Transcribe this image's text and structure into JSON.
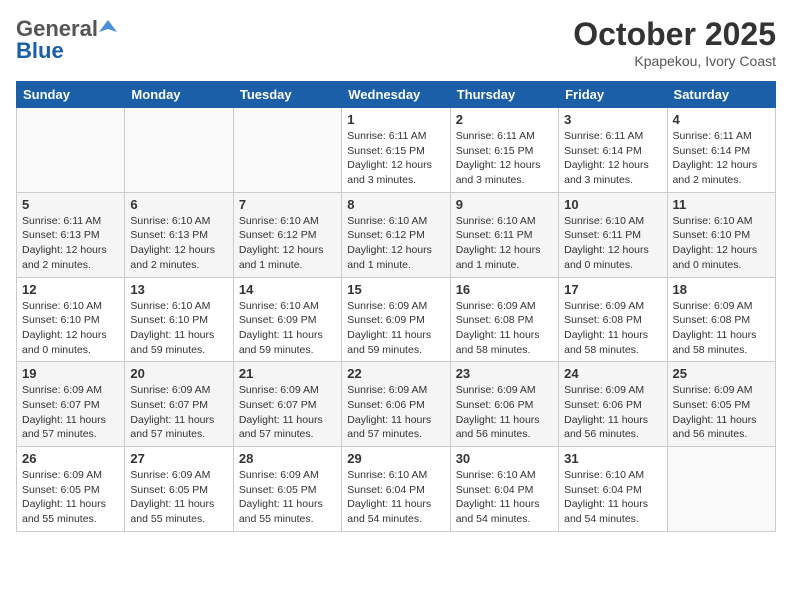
{
  "header": {
    "logo_general": "General",
    "logo_blue": "Blue",
    "month_title": "October 2025",
    "location": "Kpapekou, Ivory Coast"
  },
  "days_of_week": [
    "Sunday",
    "Monday",
    "Tuesday",
    "Wednesday",
    "Thursday",
    "Friday",
    "Saturday"
  ],
  "weeks": [
    [
      {
        "day": "",
        "content": ""
      },
      {
        "day": "",
        "content": ""
      },
      {
        "day": "",
        "content": ""
      },
      {
        "day": "1",
        "content": "Sunrise: 6:11 AM\nSunset: 6:15 PM\nDaylight: 12 hours and 3 minutes."
      },
      {
        "day": "2",
        "content": "Sunrise: 6:11 AM\nSunset: 6:15 PM\nDaylight: 12 hours and 3 minutes."
      },
      {
        "day": "3",
        "content": "Sunrise: 6:11 AM\nSunset: 6:14 PM\nDaylight: 12 hours and 3 minutes."
      },
      {
        "day": "4",
        "content": "Sunrise: 6:11 AM\nSunset: 6:14 PM\nDaylight: 12 hours and 2 minutes."
      }
    ],
    [
      {
        "day": "5",
        "content": "Sunrise: 6:11 AM\nSunset: 6:13 PM\nDaylight: 12 hours and 2 minutes."
      },
      {
        "day": "6",
        "content": "Sunrise: 6:10 AM\nSunset: 6:13 PM\nDaylight: 12 hours and 2 minutes."
      },
      {
        "day": "7",
        "content": "Sunrise: 6:10 AM\nSunset: 6:12 PM\nDaylight: 12 hours and 1 minute."
      },
      {
        "day": "8",
        "content": "Sunrise: 6:10 AM\nSunset: 6:12 PM\nDaylight: 12 hours and 1 minute."
      },
      {
        "day": "9",
        "content": "Sunrise: 6:10 AM\nSunset: 6:11 PM\nDaylight: 12 hours and 1 minute."
      },
      {
        "day": "10",
        "content": "Sunrise: 6:10 AM\nSunset: 6:11 PM\nDaylight: 12 hours and 0 minutes."
      },
      {
        "day": "11",
        "content": "Sunrise: 6:10 AM\nSunset: 6:10 PM\nDaylight: 12 hours and 0 minutes."
      }
    ],
    [
      {
        "day": "12",
        "content": "Sunrise: 6:10 AM\nSunset: 6:10 PM\nDaylight: 12 hours and 0 minutes."
      },
      {
        "day": "13",
        "content": "Sunrise: 6:10 AM\nSunset: 6:10 PM\nDaylight: 11 hours and 59 minutes."
      },
      {
        "day": "14",
        "content": "Sunrise: 6:10 AM\nSunset: 6:09 PM\nDaylight: 11 hours and 59 minutes."
      },
      {
        "day": "15",
        "content": "Sunrise: 6:09 AM\nSunset: 6:09 PM\nDaylight: 11 hours and 59 minutes."
      },
      {
        "day": "16",
        "content": "Sunrise: 6:09 AM\nSunset: 6:08 PM\nDaylight: 11 hours and 58 minutes."
      },
      {
        "day": "17",
        "content": "Sunrise: 6:09 AM\nSunset: 6:08 PM\nDaylight: 11 hours and 58 minutes."
      },
      {
        "day": "18",
        "content": "Sunrise: 6:09 AM\nSunset: 6:08 PM\nDaylight: 11 hours and 58 minutes."
      }
    ],
    [
      {
        "day": "19",
        "content": "Sunrise: 6:09 AM\nSunset: 6:07 PM\nDaylight: 11 hours and 57 minutes."
      },
      {
        "day": "20",
        "content": "Sunrise: 6:09 AM\nSunset: 6:07 PM\nDaylight: 11 hours and 57 minutes."
      },
      {
        "day": "21",
        "content": "Sunrise: 6:09 AM\nSunset: 6:07 PM\nDaylight: 11 hours and 57 minutes."
      },
      {
        "day": "22",
        "content": "Sunrise: 6:09 AM\nSunset: 6:06 PM\nDaylight: 11 hours and 57 minutes."
      },
      {
        "day": "23",
        "content": "Sunrise: 6:09 AM\nSunset: 6:06 PM\nDaylight: 11 hours and 56 minutes."
      },
      {
        "day": "24",
        "content": "Sunrise: 6:09 AM\nSunset: 6:06 PM\nDaylight: 11 hours and 56 minutes."
      },
      {
        "day": "25",
        "content": "Sunrise: 6:09 AM\nSunset: 6:05 PM\nDaylight: 11 hours and 56 minutes."
      }
    ],
    [
      {
        "day": "26",
        "content": "Sunrise: 6:09 AM\nSunset: 6:05 PM\nDaylight: 11 hours and 55 minutes."
      },
      {
        "day": "27",
        "content": "Sunrise: 6:09 AM\nSunset: 6:05 PM\nDaylight: 11 hours and 55 minutes."
      },
      {
        "day": "28",
        "content": "Sunrise: 6:09 AM\nSunset: 6:05 PM\nDaylight: 11 hours and 55 minutes."
      },
      {
        "day": "29",
        "content": "Sunrise: 6:10 AM\nSunset: 6:04 PM\nDaylight: 11 hours and 54 minutes."
      },
      {
        "day": "30",
        "content": "Sunrise: 6:10 AM\nSunset: 6:04 PM\nDaylight: 11 hours and 54 minutes."
      },
      {
        "day": "31",
        "content": "Sunrise: 6:10 AM\nSunset: 6:04 PM\nDaylight: 11 hours and 54 minutes."
      },
      {
        "day": "",
        "content": ""
      }
    ]
  ]
}
